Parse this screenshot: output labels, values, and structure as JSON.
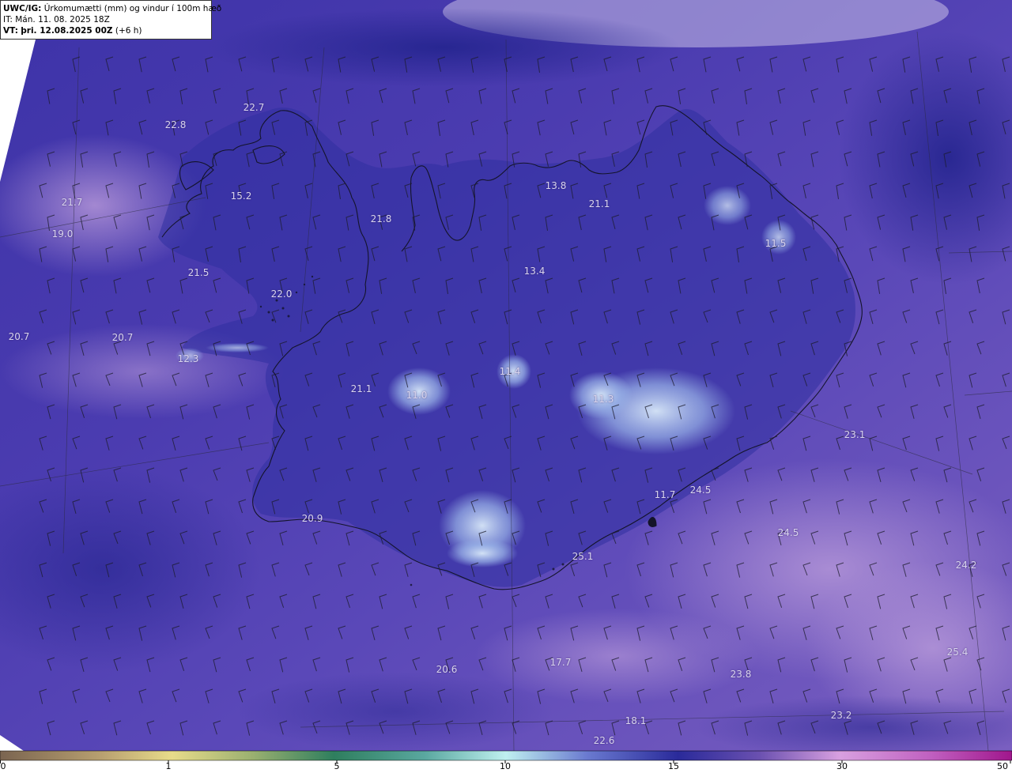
{
  "header": {
    "model": "UWC/IG:",
    "title": "Úrkomumætti (mm) og vindur í 100m hæð",
    "init_prefix": "IT:",
    "init_time": "Mán. 11. 08. 2025 18Z",
    "valid_prefix": "VT:",
    "valid_time": "þri. 12.08.2025 00Z",
    "lead": "(+6 h)"
  },
  "colors": {
    "ocean_base": "#5a4bb4",
    "deep_blue": "#2a2a9a",
    "light_purple": "#9880cc",
    "pale_highlight": "#c8d8f0",
    "coastline": "#1a1a2e",
    "barb": "#1c1c2c"
  },
  "map_values": [
    {
      "label": "22.7",
      "id": "v1"
    },
    {
      "label": "22.8",
      "id": "v2"
    },
    {
      "label": "15.2",
      "id": "v3"
    },
    {
      "label": "21.7",
      "id": "v4"
    },
    {
      "label": "19.0",
      "id": "v5"
    },
    {
      "label": "21.8",
      "id": "v6"
    },
    {
      "label": "13.8",
      "id": "v7"
    },
    {
      "label": "21.1",
      "id": "v8"
    },
    {
      "label": "11.5",
      "id": "v9"
    },
    {
      "label": "13.4",
      "id": "v10"
    },
    {
      "label": "21.5",
      "id": "v11"
    },
    {
      "label": "22.0",
      "id": "v12"
    },
    {
      "label": "20.7",
      "id": "v13"
    },
    {
      "label": "20.7",
      "id": "v14"
    },
    {
      "label": "12.3",
      "id": "v15"
    },
    {
      "label": "11.4",
      "id": "v16"
    },
    {
      "label": "21.1",
      "id": "v17"
    },
    {
      "label": "11.0",
      "id": "v18"
    },
    {
      "label": "11.3",
      "id": "v19"
    },
    {
      "label": "23.1",
      "id": "v20"
    },
    {
      "label": "11.7",
      "id": "v21"
    },
    {
      "label": "24.5",
      "id": "v22"
    },
    {
      "label": "20.9",
      "id": "v23"
    },
    {
      "label": "24.5",
      "id": "v24"
    },
    {
      "label": "25.1",
      "id": "v25"
    },
    {
      "label": "24.2",
      "id": "v26"
    },
    {
      "label": "25.4",
      "id": "v27"
    },
    {
      "label": "20.6",
      "id": "v28"
    },
    {
      "label": "17.7",
      "id": "v29"
    },
    {
      "label": "23.8",
      "id": "v30"
    },
    {
      "label": "18.1",
      "id": "v31"
    },
    {
      "label": "23.2",
      "id": "v32"
    },
    {
      "label": "22.6",
      "id": "v33"
    }
  ],
  "legend": {
    "ticks": [
      "0",
      "1",
      "5",
      "10",
      "15",
      "30",
      "50"
    ],
    "colors": [
      "#7a6450",
      "#e8dc8a",
      "#2e7e5e",
      "#bff0f0",
      "#2a2a9a",
      "#d8a0e0",
      "#a0168c"
    ]
  }
}
